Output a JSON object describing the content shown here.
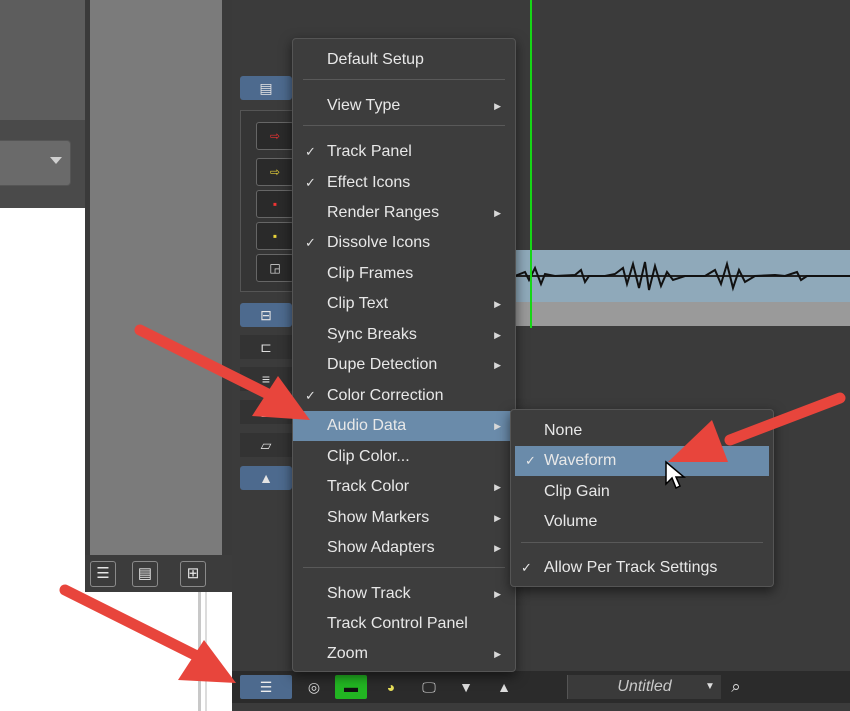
{
  "menu": {
    "items": [
      {
        "label": "Default Setup",
        "checked": false,
        "submenu": false
      },
      {
        "label": "View Type",
        "checked": false,
        "submenu": true
      },
      {
        "label": "Track Panel",
        "checked": true,
        "submenu": false
      },
      {
        "label": "Effect Icons",
        "checked": true,
        "submenu": false
      },
      {
        "label": "Render Ranges",
        "checked": false,
        "submenu": true
      },
      {
        "label": "Dissolve Icons",
        "checked": true,
        "submenu": false
      },
      {
        "label": "Clip Frames",
        "checked": false,
        "submenu": false
      },
      {
        "label": "Clip Text",
        "checked": false,
        "submenu": true
      },
      {
        "label": "Sync Breaks",
        "checked": false,
        "submenu": true
      },
      {
        "label": "Dupe Detection",
        "checked": false,
        "submenu": true
      },
      {
        "label": "Color Correction",
        "checked": true,
        "submenu": false
      },
      {
        "label": "Audio Data",
        "checked": false,
        "submenu": true,
        "highlighted": true
      },
      {
        "label": "Clip Color...",
        "checked": false,
        "submenu": false
      },
      {
        "label": "Track Color",
        "checked": false,
        "submenu": true
      },
      {
        "label": "Show Markers",
        "checked": false,
        "submenu": true
      },
      {
        "label": "Show Adapters",
        "checked": false,
        "submenu": true
      },
      {
        "label": "Show Track",
        "checked": false,
        "submenu": true
      },
      {
        "label": "Track Control Panel",
        "checked": false,
        "submenu": false
      },
      {
        "label": "Zoom",
        "checked": false,
        "submenu": true
      }
    ]
  },
  "submenu": {
    "items": [
      {
        "label": "None",
        "checked": false
      },
      {
        "label": "Waveform",
        "checked": true,
        "highlighted": true
      },
      {
        "label": "Clip Gain",
        "checked": false
      },
      {
        "label": "Volume",
        "checked": false
      },
      {
        "label": "Allow Per Track Settings",
        "checked": true
      }
    ]
  },
  "symbols": {
    "check": "✓",
    "submenu_arrow": "▶"
  },
  "bottom_bar": {
    "sequence_name": "Untitled"
  },
  "colors": {
    "menu_bg": "#3d3d3d",
    "highlight": "#6a8baa",
    "playhead": "#16d616",
    "annotation_arrow": "#e8453c",
    "waveform_clip": "#8fa9ba"
  },
  "icons": {
    "track_panel_top": "list-panel-icon",
    "record_arrows": [
      "red-arrow-icon",
      "yellow-arrow-icon",
      "red-record-icon",
      "yellow-record-icon",
      "graph-icon"
    ],
    "side_buttons": [
      "split-icon",
      "bracket-icon",
      "sliders-icon",
      "stack-icon",
      "parallelogram-icon",
      "triangle-up-icon"
    ],
    "bin_toolbar": [
      "frame-view-icon",
      "list-view-icon",
      "grid-view-icon"
    ],
    "bottom_bar": [
      "timeline-menu-icon",
      "target-icon",
      "green-monitor-icon",
      "color-icon",
      "monitor-icon",
      "step-down-icon",
      "step-up-icon",
      "dropdown-arrow-icon",
      "search-icon"
    ]
  }
}
